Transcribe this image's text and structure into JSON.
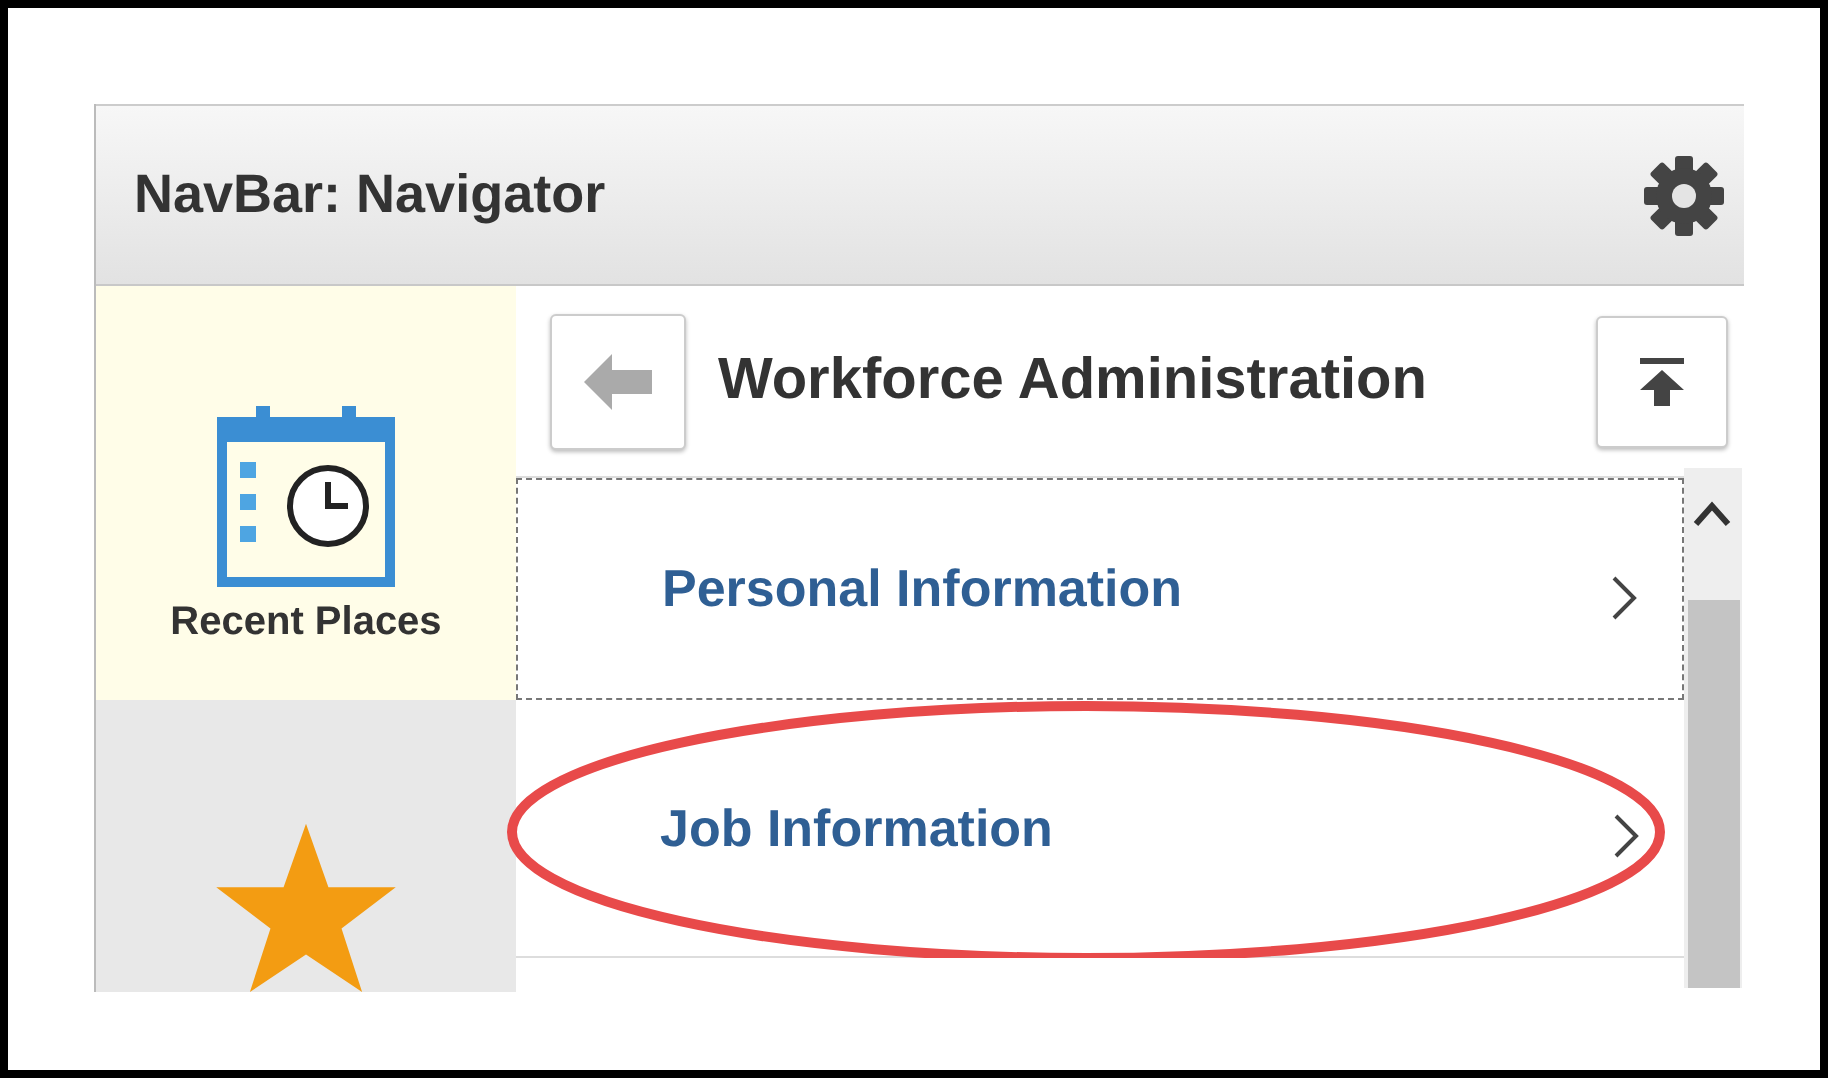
{
  "navbar": {
    "title": "NavBar: Navigator"
  },
  "tiles": [
    {
      "kind": "recent",
      "label": "Recent Places",
      "selected": true
    },
    {
      "kind": "favorites",
      "selected": false
    }
  ],
  "folder": {
    "title": "Workforce Administration"
  },
  "items": [
    {
      "label": "Personal Information",
      "focused": true,
      "circled": false
    },
    {
      "label": "Job Information",
      "focused": false,
      "circled": true
    }
  ]
}
